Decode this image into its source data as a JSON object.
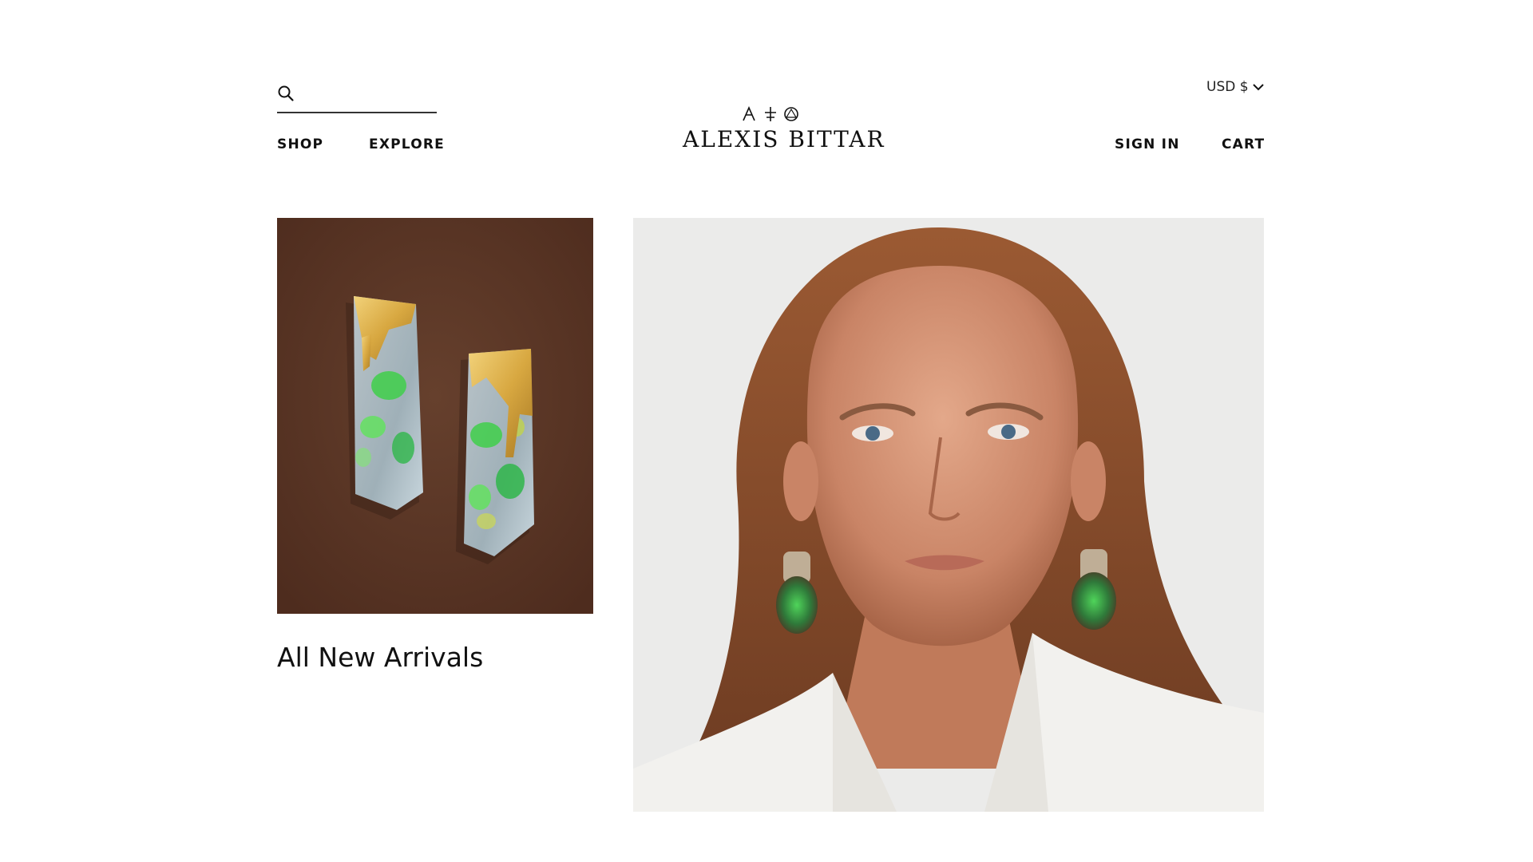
{
  "header": {
    "search": {
      "value": "",
      "placeholder": "",
      "icon": "search-icon"
    },
    "nav_left": [
      "SHOP",
      "EXPLORE"
    ],
    "nav_right": [
      "SIGN IN",
      "CART"
    ],
    "currency": {
      "label": "USD $",
      "icon": "chevron-down-icon"
    },
    "logo": {
      "wordmark": "ALEXIS BITTAR"
    }
  },
  "main": {
    "tile": {
      "title": "All New Arrivals"
    }
  },
  "colors": {
    "text": "#111111",
    "tile_background": "#5a3424",
    "hero_background": "#ebebea",
    "gold": "#d8a841",
    "green": "#3fcf4a"
  }
}
